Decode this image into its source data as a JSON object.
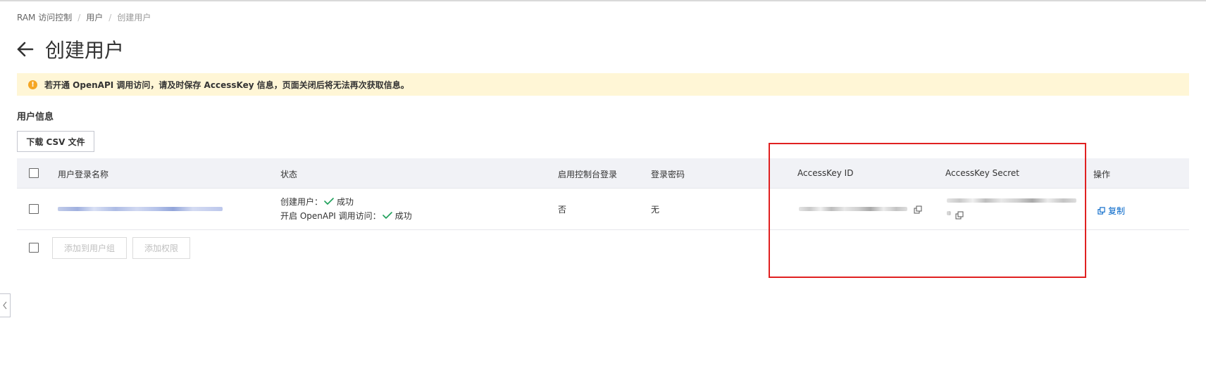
{
  "breadcrumb": {
    "items": [
      "RAM 访问控制",
      "用户",
      "创建用户"
    ]
  },
  "page": {
    "title": "创建用户",
    "alert_text": "若开通 OpenAPI 调用访问，请及时保存 AccessKey 信息，页面关闭后将无法再次获取信息。",
    "alert_icon": "!"
  },
  "section": {
    "title": "用户信息",
    "download_label": "下载 CSV 文件"
  },
  "table": {
    "headers": {
      "login_name": "用户登录名称",
      "status": "状态",
      "console_login": "启用控制台登录",
      "password": "登录密码",
      "access_key_id": "AccessKey ID",
      "access_key_secret": "AccessKey Secret",
      "actions": "操作"
    },
    "rows": [
      {
        "status_create_label": "创建用户：",
        "status_create_value": "成功",
        "status_api_label": "开启 OpenAPI 调用访问：",
        "status_api_value": "成功",
        "console_login": "否",
        "password": "无",
        "action_copy": "复制"
      }
    ]
  },
  "footer": {
    "add_to_group": "添加到用户组",
    "add_permission": "添加权限"
  },
  "colors": {
    "alert_bg": "#fff6d6",
    "warn": "#f5a623",
    "success": "#1ea05a",
    "link": "#0064c8",
    "highlight": "#e02020"
  }
}
